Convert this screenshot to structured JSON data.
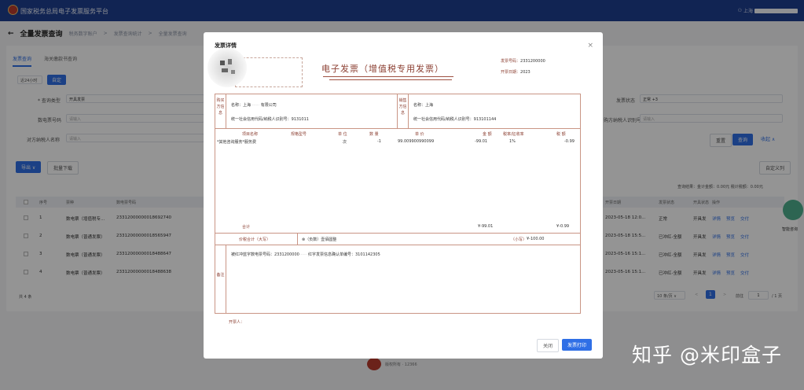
{
  "topbar": {
    "title": "国家税务总局电子发票服务平台",
    "user": "上海"
  },
  "breadcrumb": {
    "back": "←",
    "title": "全量发票查询",
    "crumbs": [
      "税务数字账户",
      "发票查询统计",
      "全量发票查询"
    ],
    "sep": ">"
  },
  "tabs": [
    "发票查询",
    "海关缴款书查询"
  ],
  "filters": {
    "range": "近24小时",
    "custom_btn": "自定",
    "type_label": "* 查询类型",
    "type_value": "开具发票",
    "no_label": "数电票号码",
    "no_placeholder": "请输入",
    "party_label": "对方纳税人名称",
    "party_placeholder": "请输入",
    "status_label": "发票状态",
    "status_value": "正常 +3",
    "taxid_label": "购方纳税人识别号",
    "taxid_placeholder": "请输入",
    "reset": "重置",
    "query": "查询",
    "collapse": "收起 ∧"
  },
  "toolbar": {
    "export": "导出 ∨",
    "batch": "批量下载",
    "custom_cols": "自定义列"
  },
  "summary": "查询结果：金计金额：0.00元  税计税额：0.00元",
  "table": {
    "headers": [
      "序号",
      "票种",
      "数电票号码",
      "开票日期",
      "发票状态",
      "开具状态",
      "操作"
    ],
    "rows": [
      {
        "no": "1",
        "kind": "数电票（增值税专...",
        "invno": "23312000000018692740",
        "date": "2023-05-18 12:0...",
        "status": "正常",
        "issue": "开具发",
        "ops": [
          "详情",
          "预览",
          "交付"
        ]
      },
      {
        "no": "2",
        "kind": "数电票（普通发票）",
        "invno": "23312000000018565947",
        "date": "2023-05-18 15:5...",
        "status": "已冲红-全额",
        "issue": "开具发",
        "ops": [
          "详情",
          "预览",
          "交付"
        ]
      },
      {
        "no": "3",
        "kind": "数电票（普通发票）",
        "invno": "23312000000018488647",
        "date": "2023-05-16 15:1...",
        "status": "已冲红-全额",
        "issue": "开具发",
        "ops": [
          "详情",
          "预览",
          "交付"
        ]
      },
      {
        "no": "4",
        "kind": "数电票（普通发票）",
        "invno": "23312000000018488638",
        "date": "2023-05-16 15:1...",
        "status": "已冲红-全额",
        "issue": "开具发",
        "ops": [
          "详情",
          "预览",
          "交付"
        ]
      }
    ]
  },
  "pagination": {
    "total": "共 4 条",
    "page_size": "10 条/页 ∨",
    "prev": "<",
    "current": "1",
    "next": ">",
    "goto_label": "前往",
    "goto_value": "1",
    "pages": "/ 1 页"
  },
  "assistant": {
    "label": "智能咨询"
  },
  "footer": {
    "text": "版权所有 · 12366"
  },
  "modal": {
    "title": "发票详情",
    "close": "×",
    "invoice_title": "电子发票（增值税专用发票）",
    "invoice_no_label": "发票号码：",
    "invoice_no_value": "2331200000",
    "invoice_date_label": "开票日期：",
    "invoice_date_value": "2023",
    "buyer_label": "购买方信息",
    "buyer_name": "名称：上海",
    "buyer_name_tail": "有限公司",
    "buyer_id": "统一社会信用代码/纳税人识别号：9131011",
    "seller_label": "销售方信息",
    "seller_name": "名称：上海",
    "seller_id": "统一社会信用代码/纳税人识别号：913101144",
    "item_headers": [
      "项目名称",
      "规格型号",
      "单 位",
      "数 量",
      "单 价",
      "金 额",
      "税率/征收率",
      "税 额"
    ],
    "item_row": [
      "*其他咨询服务*服务费",
      "",
      "次",
      "-1",
      "99.009900990099",
      "-99.01",
      "1%",
      "-0.99"
    ],
    "total_label": "合计",
    "total_amount": "¥-99.01",
    "total_tax": "¥-0.99",
    "in_words_label": "价税合计（大写）",
    "in_words_value": "⊗（负数）壹佰圆整",
    "in_small_label": "（小写）",
    "in_small_value": "¥-100.00",
    "remark_label": "备注",
    "remark_text": "被红冲蓝字数电票号码：2331200000",
    "remark_text2": "红字发票信息确认单编号：3101142305",
    "issuer_label": "开票人：",
    "btn_close": "关闭",
    "btn_print": "发票打印"
  },
  "watermark": "知乎 @米印盒子"
}
